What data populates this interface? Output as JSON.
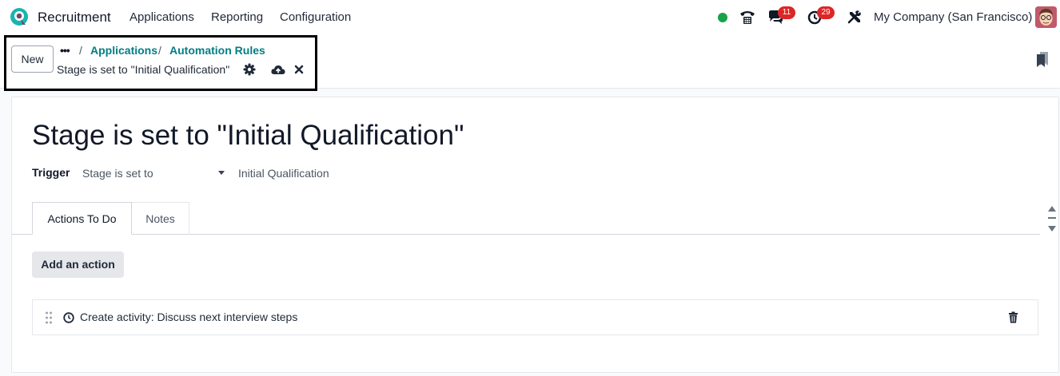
{
  "navbar": {
    "app_name": "Recruitment",
    "menu": [
      "Applications",
      "Reporting",
      "Configuration"
    ],
    "messages_badge": "11",
    "activities_badge": "29",
    "company": "My Company (San Francisco)",
    "status_color": "#16a34a"
  },
  "control_panel": {
    "new_label": "New",
    "breadcrumb_more": "•••",
    "breadcrumbs": [
      "Applications",
      "Automation Rules"
    ],
    "separator": "/",
    "record_name": "Stage is set to \"Initial Qualification\"",
    "icons": [
      "gear-icon",
      "cloud-upload-icon",
      "close-icon",
      "bookmark-icon"
    ]
  },
  "form": {
    "title": "Stage is set to \"Initial Qualification\"",
    "trigger_label": "Trigger",
    "trigger_value": "Stage is set to",
    "trigger_stage": "Initial Qualification",
    "tabs": [
      "Actions To Do",
      "Notes"
    ],
    "add_action_label": "Add an action",
    "actions": [
      {
        "icon": "clock-icon",
        "text": "Create activity: Discuss next interview steps"
      }
    ]
  },
  "colors": {
    "accent": "#017e84",
    "badge": "#dc2626",
    "logo_teal": "#1ab5b0",
    "logo_purple": "#714b67"
  }
}
